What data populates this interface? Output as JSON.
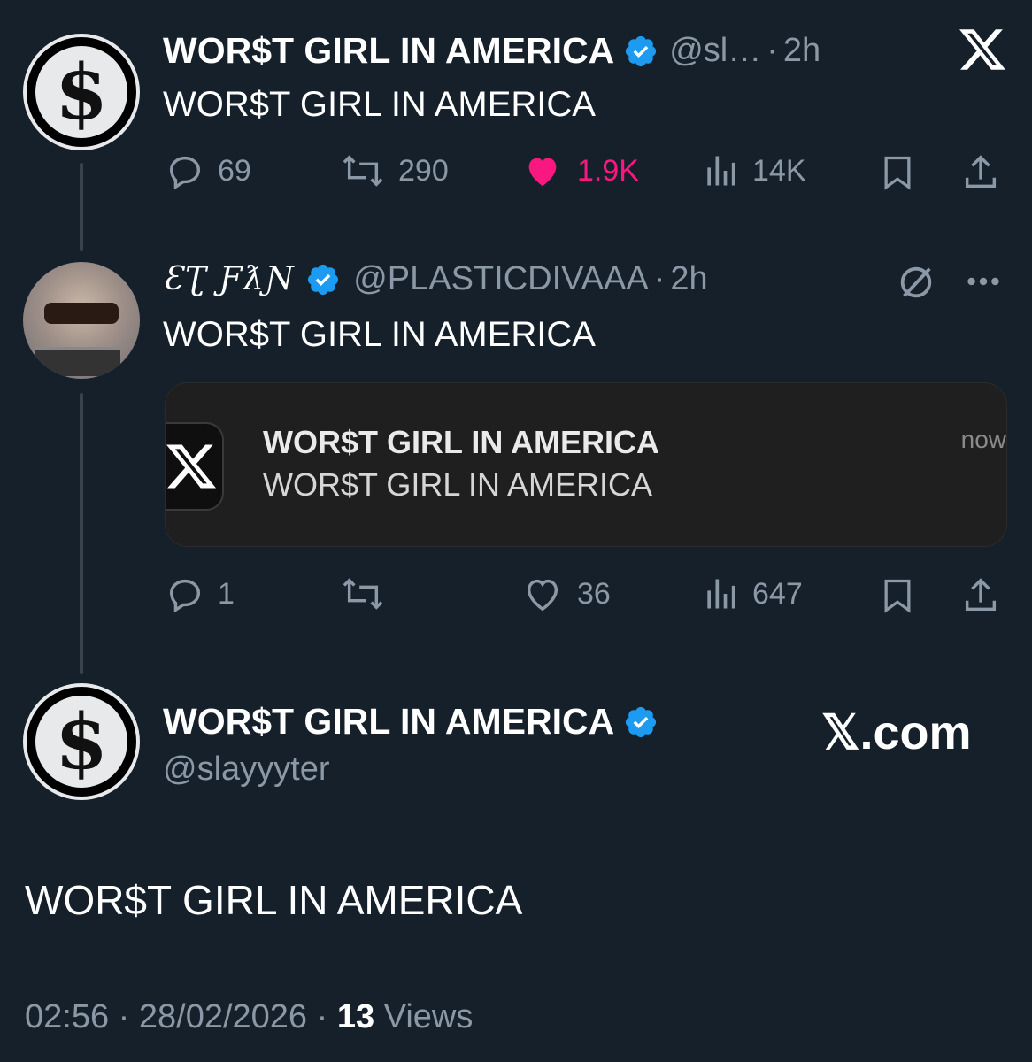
{
  "tweet1": {
    "display_name": "WOR$T GIRL IN AMERICA",
    "handle": "@sl…",
    "separator": "·",
    "time": "2h",
    "text": "WOR$T GIRL IN AMERICA",
    "replies": "69",
    "retweets": "290",
    "likes": "1.9K",
    "views": "14K",
    "like_color": "#f91880"
  },
  "tweet2": {
    "display_name": "ƐƮ ƑƛƝ",
    "handle": "@PLASTICDIVAAA",
    "separator": "·",
    "time": "2h",
    "text": "WOR$T GIRL IN AMERICA",
    "quote": {
      "title": "WOR$T GIRL IN AMERICA",
      "subtitle": "WOR$T GIRL IN AMERICA",
      "time": "now"
    },
    "replies": "1",
    "retweets": "",
    "likes": "36",
    "views": "647"
  },
  "main_tweet": {
    "display_name": "WOR$T GIRL IN AMERICA",
    "handle": "@slayyyter",
    "text": "WOR$T GIRL IN AMERICA",
    "time": "02:56",
    "date": "28/02/2026",
    "views_count": "13",
    "views_label": "Views",
    "separator": "·"
  },
  "watermark": "𝕏.com",
  "colors": {
    "background": "#15202b",
    "verified": "#1d9bf0",
    "muted": "#8b98a5"
  }
}
